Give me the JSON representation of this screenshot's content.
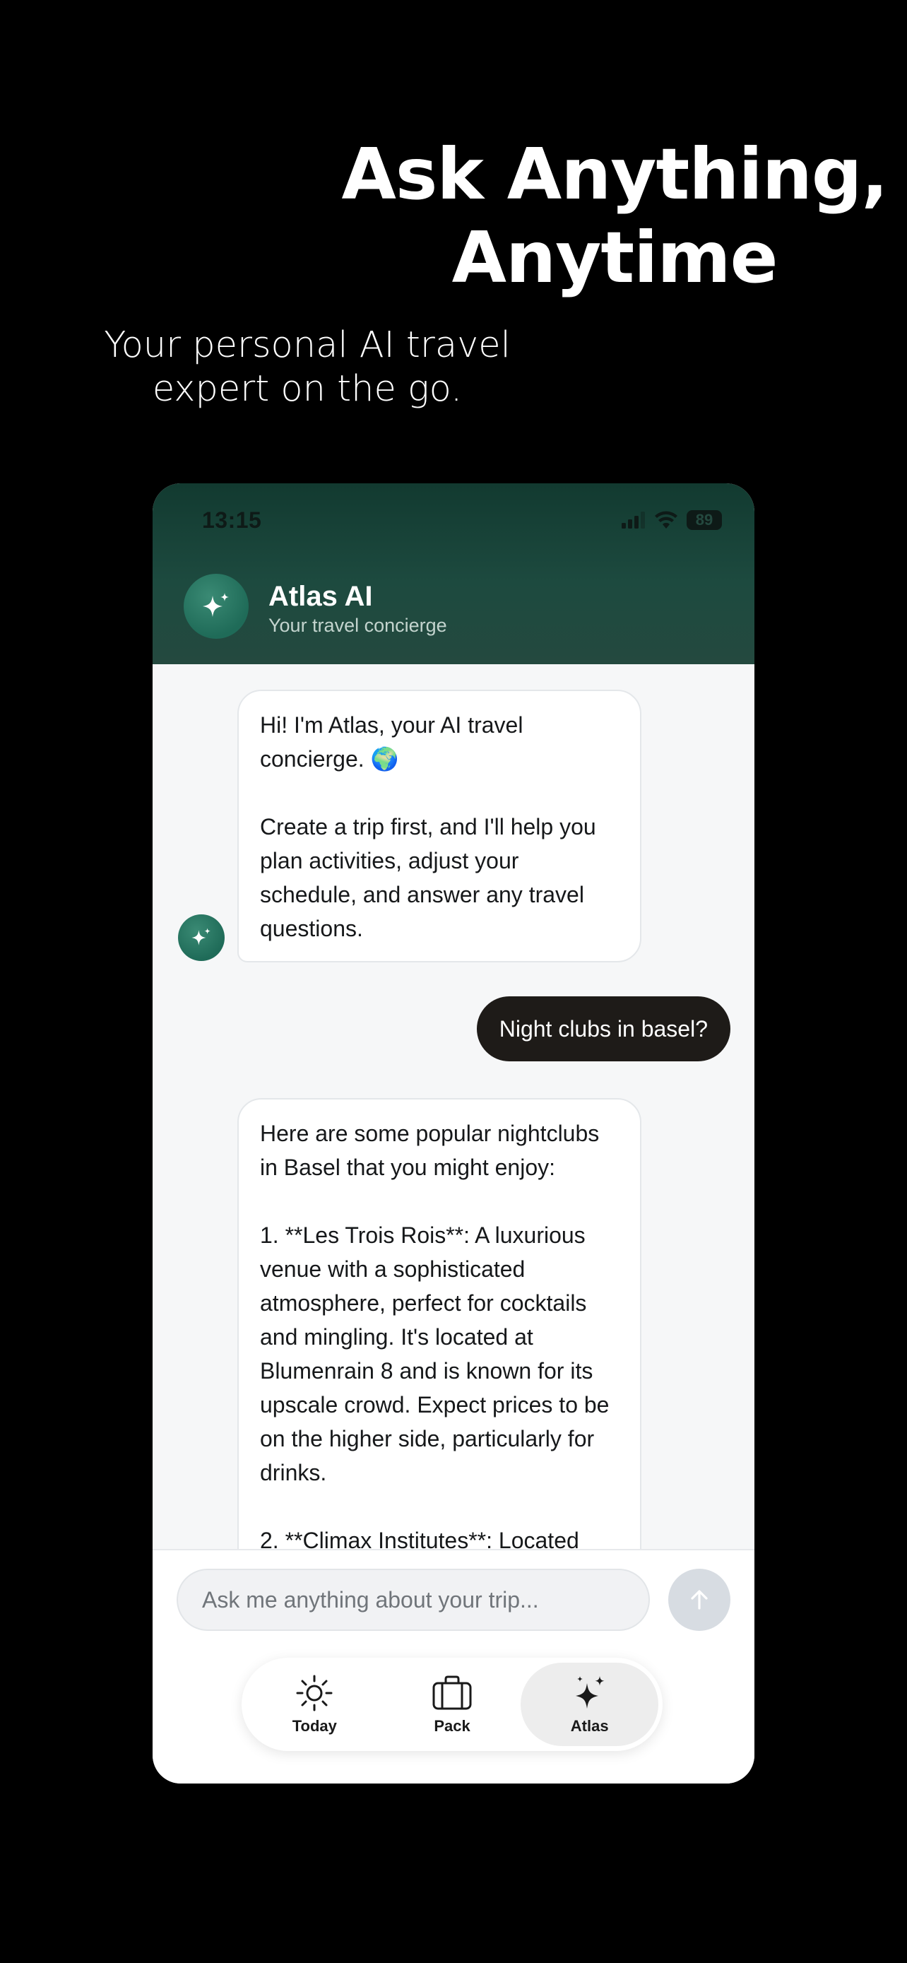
{
  "marketing": {
    "headline_line1": "Ask Anything,",
    "headline_line2": "Anytime",
    "subheadline_line1": "Your personal AI travel",
    "subheadline_line2": "expert on the go."
  },
  "status_bar": {
    "time": "13:15",
    "battery": "89",
    "icons": [
      "signal-icon",
      "wifi-icon",
      "battery-icon"
    ]
  },
  "header": {
    "title": "Atlas AI",
    "subtitle": "Your travel concierge",
    "avatar_icon": "sparkles-icon"
  },
  "messages": [
    {
      "role": "assistant",
      "text": "Hi! I'm Atlas, your AI travel concierge. 🌍\n\nCreate a trip first, and I'll help you plan activities, adjust your schedule, and answer any travel questions."
    },
    {
      "role": "user",
      "text": "Night clubs in basel?"
    },
    {
      "role": "assistant",
      "text": "Here are some popular nightclubs in Basel that you might enjoy:\n\n1. **Les Trois Rois**: A luxurious venue with a sophisticated atmosphere, perfect for cocktails and mingling. It's located at Blumenrain 8 and is known for its upscale crowd. Expect prices to be on the higher side, particularly for drinks.\n\n2. **Climax Institutes**: Located"
    }
  ],
  "composer": {
    "placeholder": "Ask me anything about your trip...",
    "send_icon": "arrow-up-icon"
  },
  "nav": {
    "items": [
      {
        "label": "Today",
        "icon": "sun-icon",
        "active": false
      },
      {
        "label": "Pack",
        "icon": "suitcase-icon",
        "active": false
      },
      {
        "label": "Atlas",
        "icon": "sparkles-icon",
        "active": true
      }
    ]
  },
  "colors": {
    "header_green": "#1d4a3f",
    "avatar_green": "#1f6b58",
    "user_bubble": "#1e1b18",
    "chat_background": "#f6f7f8",
    "send_button_disabled": "#d7dce2"
  }
}
